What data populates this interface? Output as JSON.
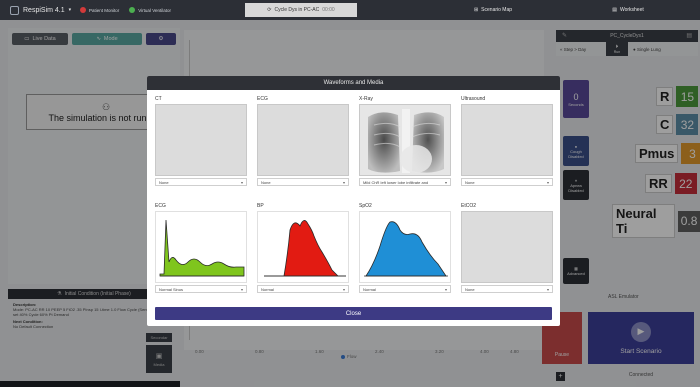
{
  "app": {
    "name": "RespiSim 4.1"
  },
  "status": {
    "patient_monitor": "Patient Monitor",
    "virtual_ventilator": "Virtual Ventilator"
  },
  "tabs": [
    {
      "label": "Cycle Dys in PC-AC",
      "meta": "00:00"
    },
    {
      "label": "Scenario Map"
    },
    {
      "label": "Worksheet"
    }
  ],
  "mode_buttons": {
    "live": "Live Data",
    "mode": "Mode"
  },
  "notice": {
    "text": "The simulation is not running"
  },
  "chart": {
    "x_ticks": [
      "0.00",
      "0.80",
      "1.60",
      "2.40",
      "3.20",
      "4.00",
      "4.80"
    ],
    "legend": "Flow"
  },
  "initial_condition": {
    "title": "Initial Condition (Initial Phase)",
    "description_label": "Description:",
    "description": "Mode: PC-AC RR 10 PEEP 5 FiO2 .35 PInsp 15 I-time 1.0 Flow Cycle (Sensitivity) In: All - set 40% Cycle 60% Pt Demand",
    "next_condition_label": "Next Condition:",
    "next_condition": "No Default Connection",
    "button_secondary": "Secondar",
    "button_media": "Media"
  },
  "right_panel": {
    "title": "PC_CycleDys1",
    "controls": {
      "prev": "Step > Day",
      "play_label": "Run",
      "single": "Single Lung"
    },
    "side_buttons": [
      {
        "value": "0",
        "label": "Seconds"
      },
      {
        "label": "Cough Disabled"
      },
      {
        "label": "Apnea Disabled"
      },
      {
        "label": "Advanced"
      }
    ],
    "params": [
      {
        "name": "R",
        "value": "15",
        "color": "#4c9a3c"
      },
      {
        "name": "C",
        "value": "32",
        "color": "#5c8fa8"
      },
      {
        "name": "Pmus",
        "value": "3",
        "color": "#e39a2c"
      },
      {
        "name": "RR",
        "value": "22",
        "color": "#c62e3a"
      },
      {
        "name": "Neural Ti",
        "value": "0.8",
        "color": "#5f5f5f"
      }
    ],
    "asl": {
      "label": "ASL Emulator",
      "pause": "Pause",
      "start": "Start Scenario",
      "connected": "Connected"
    }
  },
  "modal": {
    "title": "Waveforms and Media",
    "tiles": [
      {
        "label": "CT",
        "select": "None"
      },
      {
        "label": "ECG",
        "select": "None"
      },
      {
        "label": "X-Ray",
        "select": "Mild ChR left lower lobe infiltrate and"
      },
      {
        "label": "Ultrasound",
        "select": "None"
      },
      {
        "label": "ECG",
        "select": "Normal Sinus"
      },
      {
        "label": "BP",
        "select": "Normal"
      },
      {
        "label": "SpO2",
        "select": "Normal"
      },
      {
        "label": "EtCO2",
        "select": "None"
      }
    ],
    "close_label": "Close"
  },
  "colors": {
    "ecg": "#7fc51d",
    "bp": "#e21b12",
    "spo2": "#1f8fd6",
    "button": "#3d3a84"
  }
}
